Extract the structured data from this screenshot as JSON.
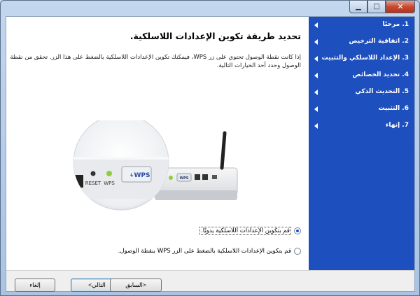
{
  "window": {
    "minimize_glyph": "▁",
    "maximize_glyph": "□",
    "close_glyph": "✕"
  },
  "heading": "تحديد طريقة تكوين الإعدادات اللاسلكية.",
  "description": "إذا كانت نقطة الوصول تحتوي على زر WPS، فيمكنك تكوين الإعدادات اللاسلكية بالضغط على هذا الزر. تحقق من نقطة الوصول وحدد أحد الخيارات التالية.",
  "steps": [
    {
      "label": "1. مرحبًا"
    },
    {
      "label": "2. اتفاقية الترخيص"
    },
    {
      "label": "3. الإعداد اللاسلكي والتثبيت",
      "active": true
    },
    {
      "label": "4. تحديد الخصائص"
    },
    {
      "label": "5. التحديث الذكي"
    },
    {
      "label": "6. التثبيت"
    },
    {
      "label": "7. إنهاء"
    }
  ],
  "illustration": {
    "reset_label": "RESET",
    "wps_led_label": "WPS",
    "wps_button_label": "WPS",
    "small_wps_label": "WPS"
  },
  "options": [
    {
      "label": "قم بتكوين الإعدادات اللاسلكية يدويًا.",
      "selected": true
    },
    {
      "label": "قم بتكوين الإعدادات اللاسلكية بالضغط على الزر WPS بنقطة الوصول.",
      "selected": false
    }
  ],
  "buttons": {
    "back": "<السابق",
    "next": "التالي>",
    "cancel": "إلغاء"
  },
  "colors": {
    "sidebar": "#1d4fbf",
    "accent_led": "#8ccf3a"
  }
}
